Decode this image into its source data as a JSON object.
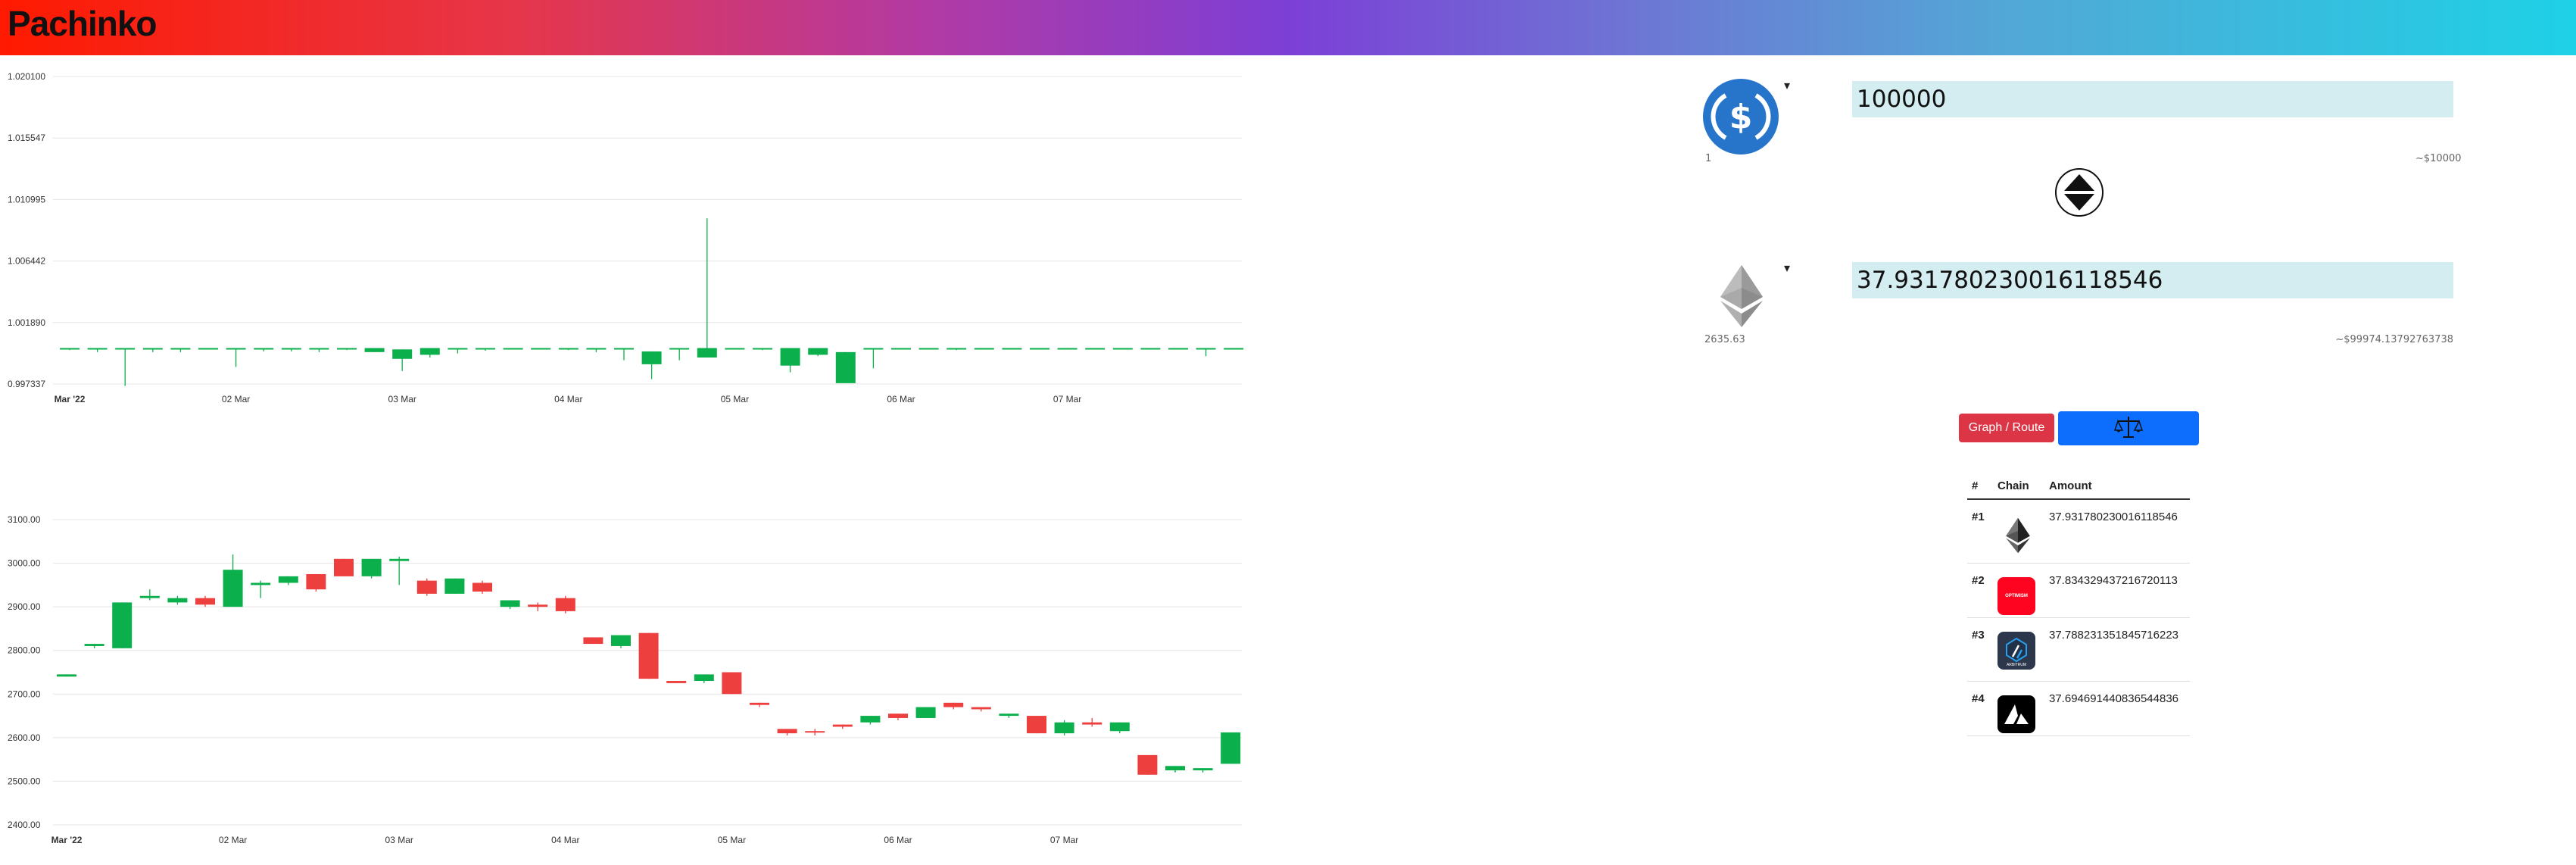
{
  "app": {
    "title": "Pachinko"
  },
  "swap": {
    "from": {
      "token_icon": "usdc-icon",
      "amount": "100000",
      "price": "1",
      "usd_value": "~$10000"
    },
    "to": {
      "token_icon": "ethereum-icon",
      "amount": "37.931780230016118546",
      "price": "2635.63",
      "usd_value": "~$99974.13792763738"
    },
    "swap_direction_icon": "swap-arrows-icon"
  },
  "actions": {
    "graph_route_label": "Graph / Route",
    "exchange_icon": "exchange-scale-icon"
  },
  "routes_table": {
    "headers": [
      "#",
      "Chain",
      "Amount"
    ],
    "rows": [
      {
        "rank": "#1",
        "chain_icon": "ethereum-icon",
        "amount": "37.931780230016118546"
      },
      {
        "rank": "#2",
        "chain_icon": "optimism-icon",
        "amount": "37.834329437216720113",
        "logo_text": "OPTIMISM"
      },
      {
        "rank": "#3",
        "chain_icon": "arbitrum-icon",
        "amount": "37.788231351845716223",
        "logo_text": "ARBITRUM"
      },
      {
        "rank": "#4",
        "chain_icon": "avalanche-icon",
        "amount": "37.694691440836544836"
      }
    ]
  },
  "colors": {
    "up": "#0bb04c",
    "down": "#ee3f3f",
    "grid": "#e4e4e4",
    "button_red": "#dc3545",
    "button_blue": "#0d6efd",
    "input_bg": "#d4edf0"
  },
  "chart_data": [
    {
      "type": "candlestick",
      "title": "",
      "y_ticks": [
        "1.020100",
        "1.015547",
        "1.010995",
        "1.006442",
        "1.001890",
        "0.997337"
      ],
      "ylim": [
        0.997337,
        1.0201
      ],
      "x_ticks": [
        {
          "label": "Mar '22",
          "at": 0,
          "bold": true
        },
        {
          "label": "02 Mar",
          "at": 6
        },
        {
          "label": "03 Mar",
          "at": 12
        },
        {
          "label": "04 Mar",
          "at": 18
        },
        {
          "label": "05 Mar",
          "at": 24
        },
        {
          "label": "06 Mar",
          "at": 30
        },
        {
          "label": "07 Mar",
          "at": 36
        }
      ],
      "candles": [
        [
          1.0,
          1.0,
          0.99985,
          1.0
        ],
        [
          1.0,
          1.0,
          0.9997,
          1.0
        ],
        [
          1.0,
          1.0,
          0.9972,
          1.0
        ],
        [
          1.0,
          1.0,
          0.9997,
          1.0
        ],
        [
          1.0,
          1.0,
          0.9997,
          1.0
        ],
        [
          1.0,
          1.0,
          1.0,
          1.0
        ],
        [
          1.0,
          1.0,
          0.9986,
          0.9987
        ],
        [
          1.0,
          1.0,
          0.99975,
          1.0
        ],
        [
          1.0,
          1.0,
          0.99975,
          1.0
        ],
        [
          1.0,
          1.0,
          0.9997,
          1.0
        ],
        [
          1.0,
          1.0,
          0.99985,
          1.0
        ],
        [
          0.9997,
          1.0,
          0.9997,
          1.0
        ],
        [
          0.9992,
          0.9999,
          0.9983,
          0.9983
        ],
        [
          0.9995,
          1.0,
          0.9993,
          0.9993
        ],
        [
          1.0,
          1.0,
          0.9996,
          1.0
        ],
        [
          1.0,
          1.0,
          0.9998,
          1.0
        ],
        [
          1.0,
          1.0,
          1.0,
          1.0
        ],
        [
          1.0,
          1.0,
          1.0,
          1.0
        ],
        [
          1.0,
          1.0,
          0.99985,
          1.0
        ],
        [
          1.0,
          1.0,
          0.9998,
          0.9997
        ],
        [
          1.0,
          1.0,
          0.9991,
          0.9991
        ],
        [
          0.9988,
          0.99975,
          0.9977,
          0.9977
        ],
        [
          1.0,
          1.0,
          0.9991,
          0.9991
        ],
        [
          0.9993,
          1.0,
          0.9993,
          1.0096
        ],
        [
          1.0,
          1.0,
          1.0,
          1.0
        ],
        [
          1.0,
          1.0,
          0.99985,
          1.0
        ],
        [
          0.9987,
          1.0,
          0.9982,
          0.9987
        ],
        [
          0.9995,
          1.0,
          0.9994,
          1.0
        ],
        [
          0.9974,
          0.9997,
          0.9974,
          0.9997
        ],
        [
          1.0,
          1.0,
          0.9985,
          1.0
        ],
        [
          1.0,
          1.0,
          1.0,
          1.0
        ],
        [
          1.0,
          1.0,
          1.0,
          1.0
        ],
        [
          1.0,
          1.0,
          0.99985,
          1.0
        ],
        [
          1.0,
          1.0,
          1.0,
          1.0
        ],
        [
          1.0,
          1.0,
          1.0,
          1.0
        ],
        [
          1.0,
          1.0,
          1.0,
          1.0
        ],
        [
          1.0,
          1.0,
          1.0,
          1.0
        ],
        [
          1.0,
          1.0,
          1.0,
          1.0
        ],
        [
          0.9999,
          1.0,
          0.9999,
          1.0
        ],
        [
          1.0,
          1.0,
          1.0,
          1.0
        ],
        [
          1.0,
          1.0,
          1.0,
          1.0
        ],
        [
          1.0,
          1.0,
          0.9994,
          1.0
        ],
        [
          1.0,
          1.0,
          1.0,
          1.0
        ],
        [
          1.0,
          1.0,
          1.0,
          1.0
        ]
      ]
    },
    {
      "type": "candlestick",
      "title": "",
      "y_ticks": [
        "3100.00",
        "3000.00",
        "2900.00",
        "2800.00",
        "2700.00",
        "2600.00",
        "2500.00",
        "2400.00"
      ],
      "ylim": [
        2400,
        3100
      ],
      "x_ticks": [
        {
          "label": "Mar '22",
          "at": 0,
          "bold": true
        },
        {
          "label": "02 Mar",
          "at": 6
        },
        {
          "label": "03 Mar",
          "at": 12
        },
        {
          "label": "04 Mar",
          "at": 18
        },
        {
          "label": "05 Mar",
          "at": 24
        },
        {
          "label": "06 Mar",
          "at": 30
        },
        {
          "label": "07 Mar",
          "at": 36
        }
      ],
      "candles": [
        [
          2740,
          2745,
          2740,
          2740
        ],
        [
          2810,
          2815,
          2815,
          2805
        ],
        [
          2805,
          2910,
          2910,
          2805
        ],
        [
          2920,
          2925,
          2940,
          2915
        ],
        [
          2910,
          2920,
          2925,
          2905
        ],
        [
          2920,
          2905,
          2925,
          2900
        ],
        [
          2900,
          2985,
          3020,
          2900
        ],
        [
          2950,
          2955,
          2960,
          2920
        ],
        [
          2955,
          2970,
          2970,
          2950
        ],
        [
          2975,
          2940,
          2975,
          2935
        ],
        [
          3010,
          2970,
          3010,
          2970
        ],
        [
          2970,
          3010,
          3010,
          2965
        ],
        [
          3005,
          3010,
          3015,
          2950
        ],
        [
          2960,
          2930,
          2965,
          2925
        ],
        [
          2930,
          2965,
          2965,
          2930
        ],
        [
          2955,
          2935,
          2960,
          2930
        ],
        [
          2900,
          2915,
          2915,
          2895
        ],
        [
          2905,
          2900,
          2910,
          2890
        ],
        [
          2920,
          2890,
          2925,
          2885
        ],
        [
          2830,
          2815,
          2830,
          2815
        ],
        [
          2810,
          2835,
          2835,
          2805
        ],
        [
          2840,
          2735,
          2840,
          2735
        ],
        [
          2730,
          2725,
          2730,
          2725
        ],
        [
          2730,
          2745,
          2745,
          2725
        ],
        [
          2750,
          2700,
          2750,
          2700
        ],
        [
          2680,
          2675,
          2680,
          2670
        ],
        [
          2620,
          2610,
          2620,
          2605
        ],
        [
          2615,
          2612,
          2620,
          2605
        ],
        [
          2630,
          2625,
          2630,
          2620
        ],
        [
          2635,
          2650,
          2650,
          2630
        ],
        [
          2655,
          2645,
          2655,
          2640
        ],
        [
          2645,
          2670,
          2670,
          2645
        ],
        [
          2680,
          2670,
          2680,
          2665
        ],
        [
          2670,
          2665,
          2670,
          2660
        ],
        [
          2650,
          2655,
          2655,
          2645
        ],
        [
          2650,
          2610,
          2650,
          2610
        ],
        [
          2610,
          2635,
          2640,
          2605
        ],
        [
          2635,
          2630,
          2645,
          2625
        ],
        [
          2615,
          2635,
          2635,
          2610
        ],
        [
          2560,
          2515,
          2560,
          2515
        ],
        [
          2525,
          2535,
          2535,
          2520
        ],
        [
          2525,
          2530,
          2530,
          2520
        ],
        [
          2540,
          2612,
          2612,
          2540
        ]
      ]
    }
  ]
}
